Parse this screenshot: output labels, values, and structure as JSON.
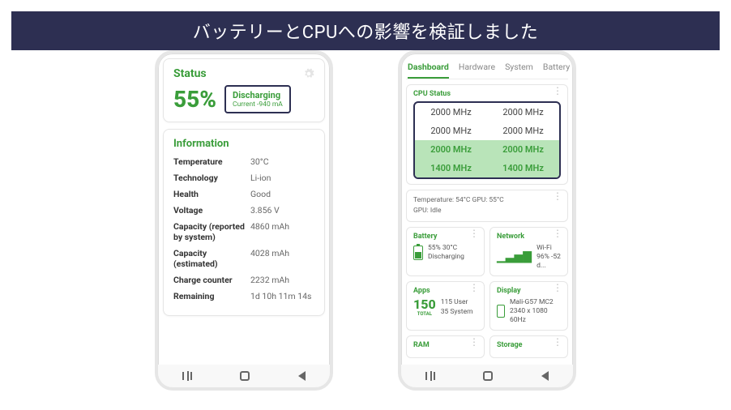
{
  "banner": "バッテリーとCPUへの影響を検証しました",
  "phone1": {
    "status": {
      "title": "Status",
      "percent": "55%",
      "state": "Discharging",
      "current": "Current -940 mA"
    },
    "info": {
      "title": "Information",
      "rows": [
        {
          "k": "Temperature",
          "v": "30°C"
        },
        {
          "k": "Technology",
          "v": "Li-ion"
        },
        {
          "k": "Health",
          "v": "Good"
        },
        {
          "k": "Voltage",
          "v": "3.856 V"
        },
        {
          "k": "Capacity (reported by system)",
          "v": "4860 mAh"
        },
        {
          "k": "Capacity (estimated)",
          "v": "4028 mAh"
        },
        {
          "k": "Charge counter",
          "v": "2232 mAh"
        },
        {
          "k": "Remaining",
          "v": "1d 10h 11m 14s"
        }
      ]
    }
  },
  "phone2": {
    "tabs": [
      "Dashboard",
      "Hardware",
      "System",
      "Battery"
    ],
    "cpu": {
      "title": "CPU Status",
      "rows": [
        [
          "2000 MHz",
          "2000 MHz"
        ],
        [
          "2000 MHz",
          "2000 MHz"
        ],
        [
          "2000 MHz",
          "2000 MHz"
        ],
        [
          "1400 MHz",
          "1400 MHz"
        ]
      ]
    },
    "temps": {
      "line1": "Temperature: 54°C    GPU: 55°C",
      "line2": "GPU: Idle"
    },
    "battery": {
      "title": "Battery",
      "l1": "55%   30°C",
      "l2": "Discharging"
    },
    "network": {
      "title": "Network",
      "l1": "Wi-Fi",
      "l2": "96%   -52 d..."
    },
    "apps": {
      "title": "Apps",
      "count": "150",
      "total": "TOTAL",
      "l1": "115 User",
      "l2": "35 System"
    },
    "display": {
      "title": "Display",
      "l1": "Mali-G57 MC2",
      "l2": "2340 x 1080",
      "l3": "60Hz"
    },
    "ram": {
      "title": "RAM"
    },
    "storage": {
      "title": "Storage"
    }
  }
}
